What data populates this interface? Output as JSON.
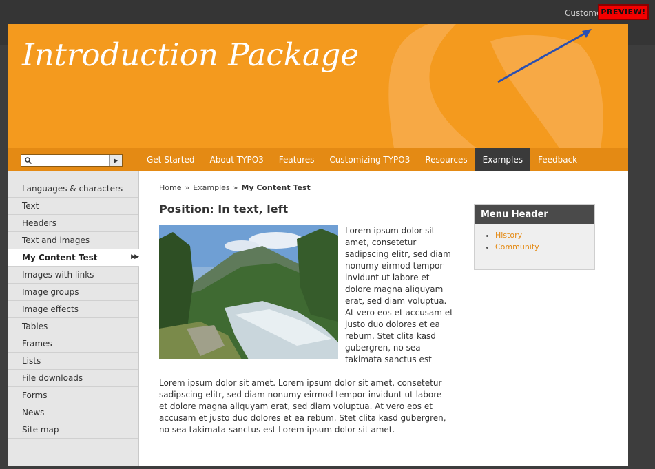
{
  "preview": {
    "customize_text": "Custome",
    "badge_label": "PREVIEW!"
  },
  "header": {
    "title": "Introduction Package"
  },
  "search": {
    "placeholder": "",
    "go_icon": "triangle-right-icon"
  },
  "nav": {
    "items": [
      {
        "label": "Get Started"
      },
      {
        "label": "About TYPO3"
      },
      {
        "label": "Features"
      },
      {
        "label": "Customizing TYPO3"
      },
      {
        "label": "Resources"
      },
      {
        "label": "Examples"
      },
      {
        "label": "Feedback"
      }
    ],
    "active_label": "Examples"
  },
  "sidebar": {
    "items": [
      {
        "label": "Languages & characters"
      },
      {
        "label": "Text"
      },
      {
        "label": "Headers"
      },
      {
        "label": "Text and images"
      },
      {
        "label": "My Content Test"
      },
      {
        "label": "Images with links"
      },
      {
        "label": "Image groups"
      },
      {
        "label": "Image effects"
      },
      {
        "label": "Tables"
      },
      {
        "label": "Frames"
      },
      {
        "label": "Lists"
      },
      {
        "label": "File downloads"
      },
      {
        "label": "Forms"
      },
      {
        "label": "News"
      },
      {
        "label": "Site map"
      }
    ],
    "active_label": "My Content Test",
    "active_arrow": "▶▶"
  },
  "breadcrumb": {
    "items": [
      "Home",
      "Examples",
      "My Content Test"
    ],
    "separator": "»"
  },
  "content": {
    "title": "Position: In text, left",
    "float_text": "Lorem ipsum dolor sit amet, consetetur sadipscing elitr, sed diam nonumy eirmod tempor invidunt ut labore et dolore magna aliquyam erat, sed diam voluptua. At vero eos et accusam et justo duo dolores et ea rebum. Stet clita kasd gubergren, no sea takimata sanctus est",
    "wide_text": "Lorem ipsum dolor sit amet. Lorem ipsum dolor sit amet, consetetur sadipscing elitr, sed diam nonumy eirmod tempor invidunt ut labore et dolore magna aliquyam erat, sed diam voluptua. At vero eos et accusam et justo duo dolores et ea rebum. Stet clita kasd gubergren, no sea takimata sanctus est Lorem ipsum dolor sit amet."
  },
  "menu_box": {
    "header": "Menu Header",
    "links": [
      {
        "label": "History"
      },
      {
        "label": "Community"
      }
    ]
  },
  "colors": {
    "brand_orange": "#f49a1e",
    "nav_orange": "#e48a14",
    "active_nav": "#3a3a3a",
    "preview_red": "#f40000",
    "link_orange": "#e48a14"
  }
}
